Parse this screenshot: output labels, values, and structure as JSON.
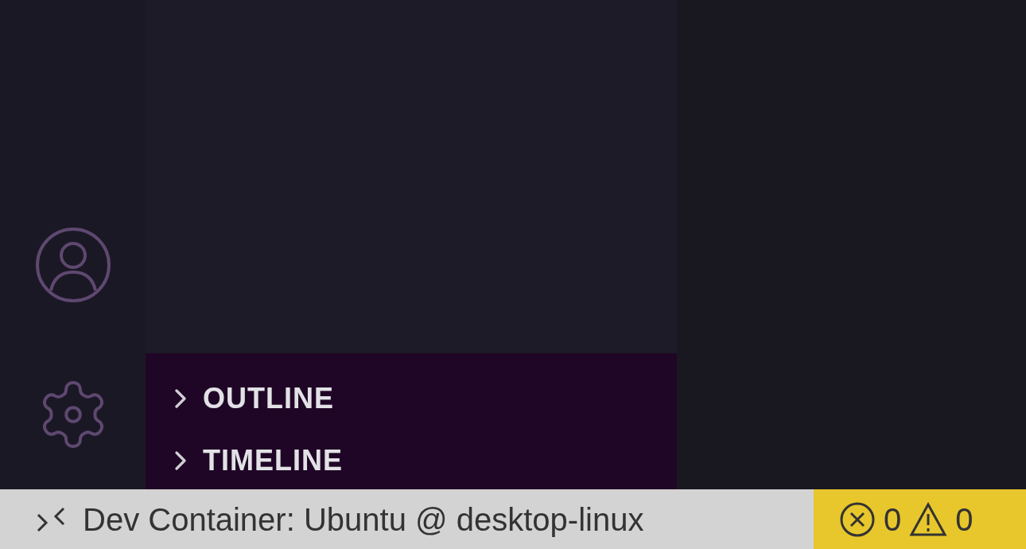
{
  "sidebar": {
    "sections": [
      {
        "label": "OUTLINE",
        "expanded": false
      },
      {
        "label": "TIMELINE",
        "expanded": false
      }
    ]
  },
  "status_bar": {
    "remote": "Dev Container: Ubuntu @ desktop-linux",
    "errors": "0",
    "warnings": "0"
  }
}
